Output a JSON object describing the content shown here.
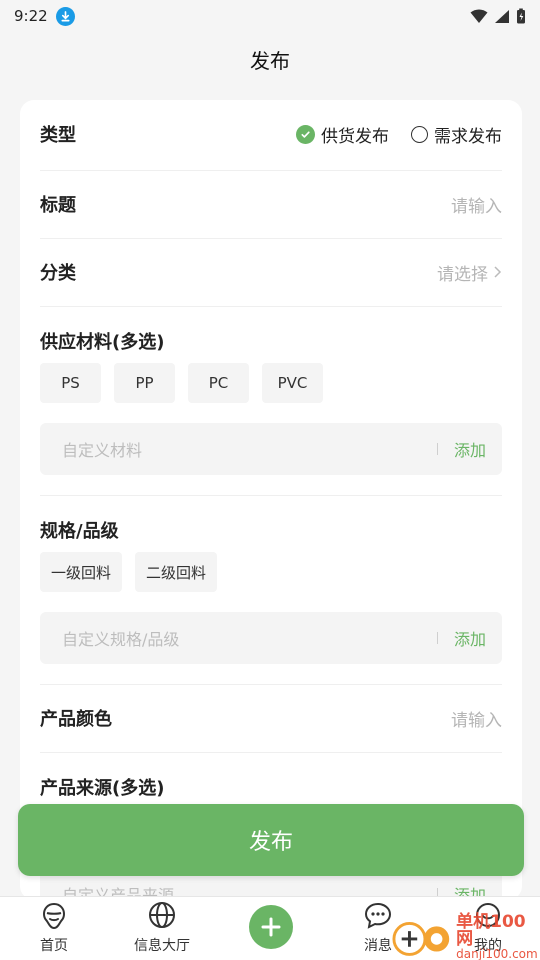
{
  "status_bar": {
    "time": "9:22"
  },
  "header": {
    "title": "发布"
  },
  "form": {
    "type": {
      "label": "类型",
      "options": [
        "供货发布",
        "需求发布"
      ],
      "selected": "供货发布"
    },
    "title": {
      "label": "标题",
      "placeholder": "请输入"
    },
    "category": {
      "label": "分类",
      "placeholder": "请选择"
    },
    "materials": {
      "label": "供应材料(多选)",
      "chips": [
        "PS",
        "PP",
        "PC",
        "PVC"
      ],
      "custom_placeholder": "自定义材料",
      "add_label": "添加"
    },
    "specs": {
      "label": "规格/品级",
      "chips": [
        "一级回料",
        "二级回料"
      ],
      "custom_placeholder": "自定义规格/品级",
      "add_label": "添加"
    },
    "color": {
      "label": "产品颜色",
      "placeholder": "请输入"
    },
    "source": {
      "label": "产品来源(多选)",
      "custom_placeholder": "自定义产品来源",
      "add_label": "添加"
    }
  },
  "publish_button": {
    "label": "发布"
  },
  "tabbar": {
    "items": [
      "首页",
      "信息大厅",
      "消息",
      "我的"
    ]
  },
  "watermark": {
    "line1": "单机100网",
    "line2": "danji100.com"
  },
  "colors": {
    "accent": "#6ab565",
    "background": "#f5f5f5"
  }
}
